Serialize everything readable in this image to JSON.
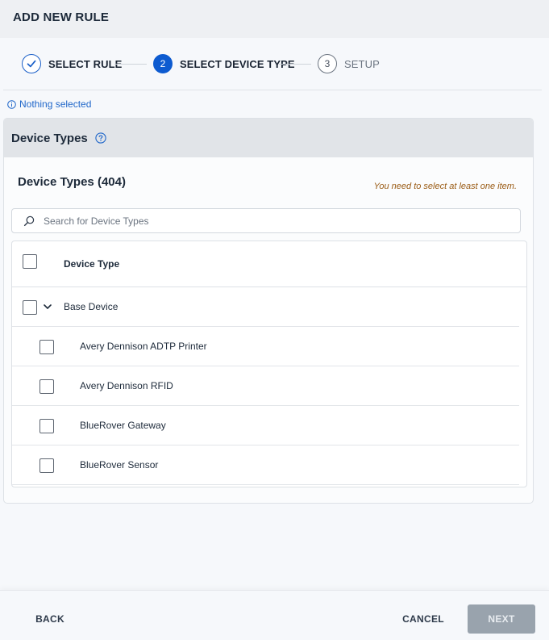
{
  "header": {
    "title": "ADD NEW RULE"
  },
  "stepper": {
    "steps": [
      {
        "number": "1",
        "label": "SELECT RULE",
        "state": "done"
      },
      {
        "number": "2",
        "label": "SELECT DEVICE TYPE",
        "state": "active"
      },
      {
        "number": "3",
        "label": "SETUP",
        "state": "todo"
      }
    ]
  },
  "selection": {
    "status": "Nothing selected"
  },
  "panel": {
    "title": "Device Types",
    "list_title": "Device Types (404)",
    "validation_message": "You need to select at least one item.",
    "search_placeholder": "Search for Device Types",
    "column_header": "Device Type",
    "group": {
      "label": "Base Device",
      "expanded": true
    },
    "rows": [
      {
        "label": "Avery Dennison ADTP Printer",
        "checked": false
      },
      {
        "label": "Avery Dennison RFID",
        "checked": false
      },
      {
        "label": "BlueRover Gateway",
        "checked": false
      },
      {
        "label": "BlueRover Sensor",
        "checked": false
      }
    ]
  },
  "footer": {
    "back_label": "BACK",
    "cancel_label": "CANCEL",
    "next_label": "NEXT"
  },
  "colors": {
    "accent": "#0d5bd0",
    "warning_text": "#9a5b14",
    "disabled_button": "#99a3ad"
  },
  "icons": {
    "step_done": "checkmark-icon",
    "selection_info": "info-icon",
    "panel_help": "help-circle-icon",
    "search": "search-icon",
    "group_toggle": "chevron-down-icon"
  }
}
